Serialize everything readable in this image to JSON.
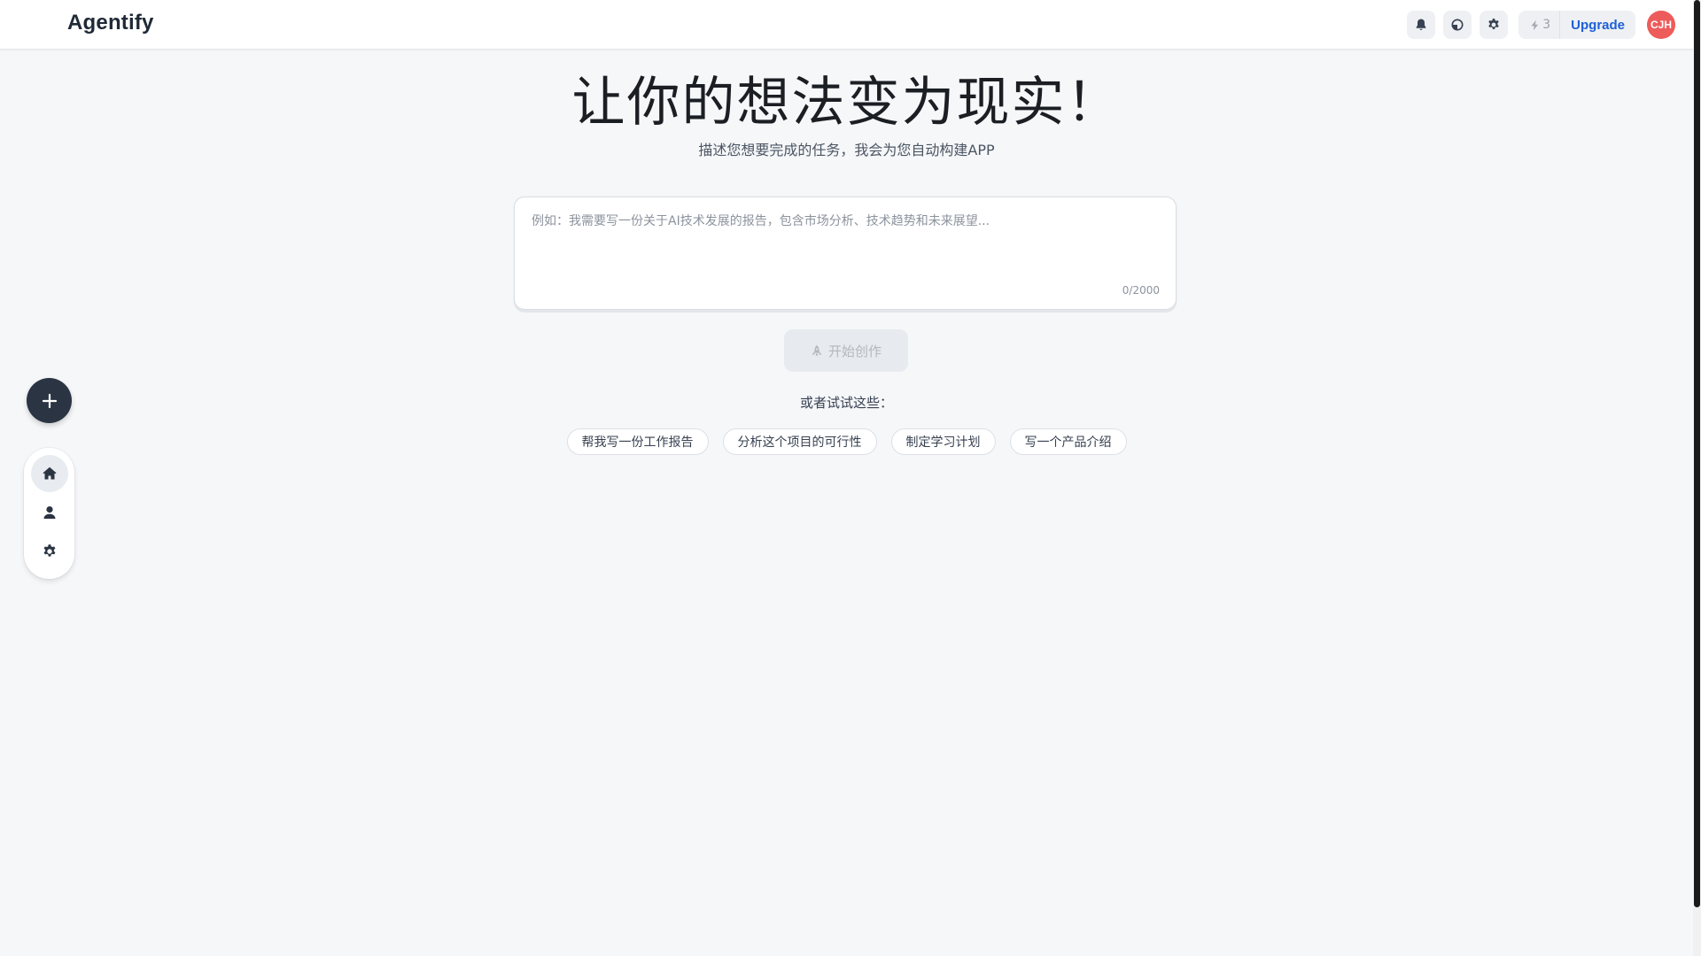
{
  "header": {
    "brand": "Agentify",
    "credits": "3",
    "upgrade_label": "Upgrade",
    "avatar_initials": "CJH",
    "avatar_color": "#ee5b5b",
    "icons": [
      "bell-icon",
      "theme-toggle-icon",
      "gear-icon",
      "lightning-icon"
    ]
  },
  "hero": {
    "title": "让你的想法变为现实！",
    "subtitle": "描述您想要完成的任务，我会为您自动构建APP"
  },
  "prompt": {
    "placeholder": "例如：我需要写一份关于AI技术发展的报告，包含市场分析、技术趋势和未来展望...",
    "value": "",
    "counter": "0/2000"
  },
  "start_button": {
    "label": "开始创作",
    "icon": "rocket-icon",
    "disabled": true
  },
  "suggestions": {
    "label": "或者试试这些：",
    "items": [
      "帮我写一份工作报告",
      "分析这个项目的可行性",
      "制定学习计划",
      "写一个产品介绍"
    ]
  },
  "side_nav": {
    "fab_icon": "plus-icon",
    "items": [
      {
        "name": "home",
        "icon": "home-icon",
        "active": true
      },
      {
        "name": "profile",
        "icon": "user-icon",
        "active": false
      },
      {
        "name": "settings",
        "icon": "gear-icon",
        "active": false
      }
    ]
  },
  "colors": {
    "background": "#f6f7f9",
    "accent": "#1d5fd6",
    "fab": "#2b3442"
  }
}
